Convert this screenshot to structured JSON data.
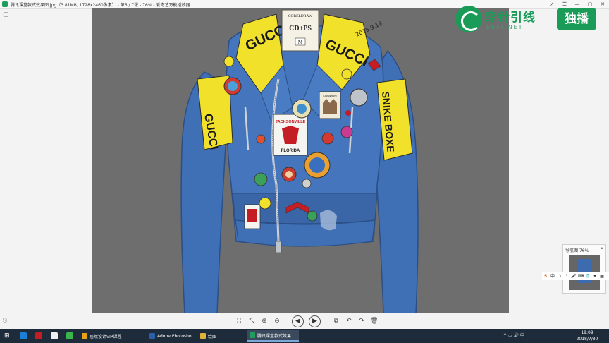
{
  "window": {
    "title": "腾讯课堂款式效果图.jpg（3.81MB, 1728x2460像素） - 第6 / 7张 - 76% - 爱奇艺万能播放器",
    "controls": [
      "↗",
      "☰",
      "—",
      "▢",
      "✕"
    ]
  },
  "watermark": {
    "brand": "穿针引线",
    "url": "EEFF.NET",
    "live": "独播"
  },
  "image": {
    "tag_brand": "CORELDRAW",
    "tag_main": "CD+PS",
    "tag_size": "M",
    "signature": "2015.9.19",
    "badge_jacksonville": "JACKSONVILLE",
    "badge_florida": "FLORIDA",
    "badge_london": "LONDON",
    "collar_text": "GUCCI",
    "sleeve_text": "SNIKE BOXE",
    "colors": {
      "denim": "#3f6fb5",
      "background": "#6e6e6e",
      "yellow": "#f2e12a",
      "red": "#c41e24"
    }
  },
  "bottom_toolbar": {
    "left_icon": "share-icon",
    "buttons": [
      "⛶",
      "⤡",
      "⊕",
      "⊖",
      "◀",
      "▶",
      "⧉",
      "↶",
      "↷",
      "🗑"
    ]
  },
  "navigator": {
    "title": "导航图  76%",
    "close": "×"
  },
  "ime": {
    "items": [
      "S",
      "中",
      "☽",
      "°",
      "🎤",
      "⌨",
      "👕",
      "✦",
      "▦"
    ]
  },
  "taskbar": {
    "apps": [
      {
        "label": "居然设计VIP课程",
        "color": "#e3a21a"
      },
      {
        "label": "Adobe Photosho...",
        "color": "#2b5fa6"
      },
      {
        "label": "绘图",
        "color": "#e0b23a"
      },
      {
        "label": "腾讯课堂款式效果...",
        "color": "#1e9e5a"
      }
    ],
    "tray": "^ ▭ 🔊 中",
    "time": "19:09",
    "date": "2018/7/30"
  }
}
